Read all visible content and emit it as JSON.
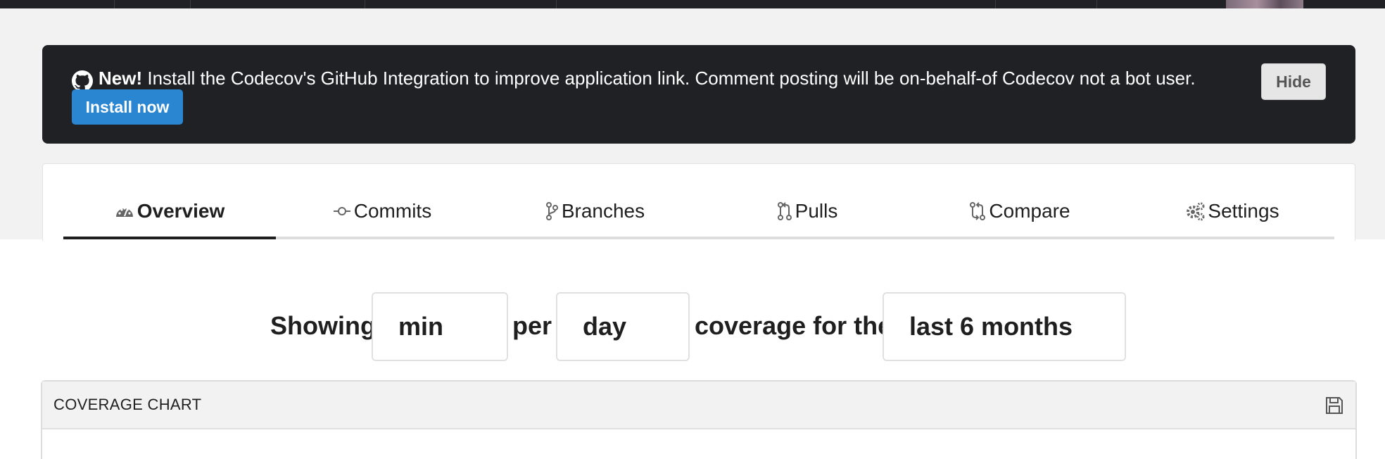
{
  "banner": {
    "new_label": "New!",
    "message": "Install the Codecov's GitHub Integration to improve application link. Comment posting will be on-behalf-of Codecov not a bot user.",
    "install_label": "Install now",
    "hide_label": "Hide"
  },
  "tabs": [
    {
      "label": "Overview",
      "icon": "dashboard-icon",
      "active": true
    },
    {
      "label": "Commits",
      "icon": "commit-icon",
      "active": false
    },
    {
      "label": "Branches",
      "icon": "branch-icon",
      "active": false
    },
    {
      "label": "Pulls",
      "icon": "pull-request-icon",
      "active": false
    },
    {
      "label": "Compare",
      "icon": "compare-icon",
      "active": false
    },
    {
      "label": "Settings",
      "icon": "gears-icon",
      "active": false
    }
  ],
  "filter": {
    "showing_label": "Showing",
    "agg_value": "min",
    "per_label": "per",
    "interval_value": "day",
    "coverage_for_label": "coverage for the",
    "range_value": "last 6 months"
  },
  "panel": {
    "title": "COVERAGE CHART",
    "save_icon": "save-icon"
  },
  "colors": {
    "banner_bg": "#1f2124",
    "install_button": "#2a86d1",
    "page_band": "#f2f2f2"
  }
}
